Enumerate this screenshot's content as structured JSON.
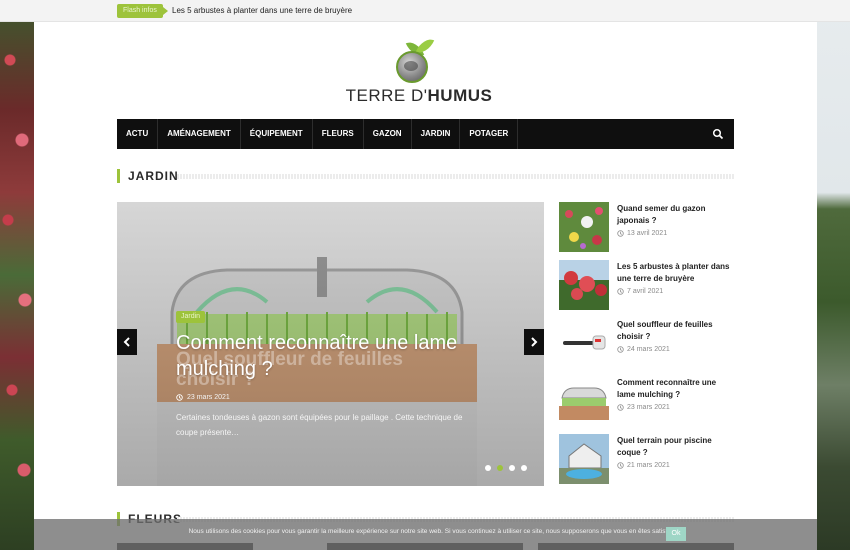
{
  "flash": {
    "badge": "Flash infos",
    "text": "Les 5 arbustes à planter dans une terre de bruyère"
  },
  "logo": {
    "text_light": "TERRE D'",
    "text_bold": "HUMUS"
  },
  "nav": {
    "items": [
      "ACTU",
      "AMÉNAGEMENT",
      "ÉQUIPEMENT",
      "FLEURS",
      "GAZON",
      "JARDIN",
      "POTAGER"
    ],
    "search_icon": "search-icon"
  },
  "sections": {
    "jardin": "JARDIN",
    "fleurs": "FLEURS"
  },
  "slider": {
    "badge": "Jardin",
    "title": "Comment reconnaître une lame mulching ?",
    "ghost_title": "Quel souffleur de feuilles choisir ?",
    "date": "23 mars 2021",
    "excerpt": "Certaines tondeuses à gazon sont équipées pour le paillage . Cette technique de coupe présente…",
    "slides": 4,
    "active_slide": 2
  },
  "posts": [
    {
      "title": "Quand semer du gazon japonais ?",
      "date": "13 avril 2021"
    },
    {
      "title": "Les 5 arbustes à planter dans une terre de bruyère",
      "date": "7 avril 2021"
    },
    {
      "title": "Quel souffleur de feuilles choisir ?",
      "date": "24 mars 2021"
    },
    {
      "title": "Comment reconnaître une lame mulching ?",
      "date": "23 mars 2021"
    },
    {
      "title": "Quel terrain pour piscine coque ?",
      "date": "21 mars 2021"
    }
  ],
  "cookie": {
    "text": "Nous utilisons des cookies pour vous garantir la meilleure expérience sur notre site web. Si vous continuez à utiliser ce site, nous supposerons que vous en êtes satisfait.",
    "ok": "Ok"
  },
  "colors": {
    "accent": "#9dc33b",
    "nav_bg": "#0f0f0f"
  }
}
